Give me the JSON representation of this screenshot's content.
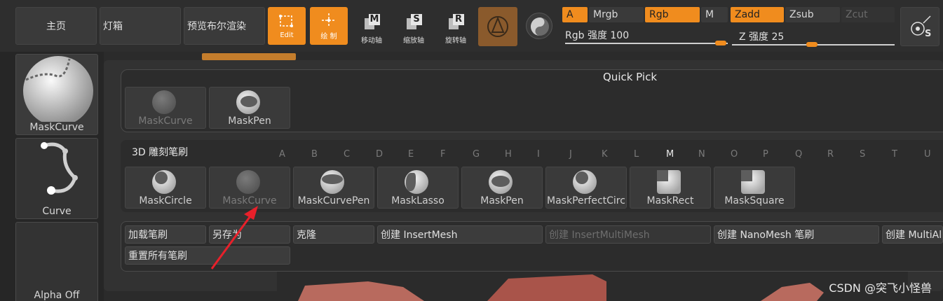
{
  "topbar": {
    "home": "主页",
    "lightbox": "灯箱",
    "preview_bool": "预览布尔渲染",
    "edit": "Edit",
    "draw": "绘 制",
    "move_label": "移动轴",
    "scale_label": "缩放轴",
    "rotate_label": "旋转轴",
    "move_letter": "M",
    "scale_letter": "S",
    "rotate_letter": "R",
    "a": "A",
    "mrgb": "Mrgb",
    "rgb": "Rgb",
    "m": "M",
    "zadd": "Zadd",
    "zsub": "Zsub",
    "zcut": "Zcut",
    "rgb_intensity": "Rgb 强度 100",
    "z_intensity": "Z 强度 25",
    "rgb_intensity_value": 100,
    "z_intensity_value": 25,
    "sym_letter": "S"
  },
  "lefttray": {
    "brush_name": "MaskCurve",
    "stroke_name": "Curve",
    "alpha_name": "Alpha Off"
  },
  "quick_pick": {
    "title": "Quick Pick",
    "items": [
      "MaskCurve",
      "MaskPen"
    ]
  },
  "sculpt": {
    "title": "3D 雕刻笔刷",
    "letters": [
      "A",
      "B",
      "C",
      "D",
      "E",
      "F",
      "G",
      "H",
      "I",
      "J",
      "K",
      "L",
      "M",
      "N",
      "O",
      "P",
      "Q",
      "R",
      "S",
      "T",
      "U"
    ],
    "active_letter": "M",
    "brushes": [
      "MaskCircle",
      "MaskCurve",
      "MaskCurvePen",
      "MaskLasso",
      "MaskPen",
      "MaskPerfectCirc",
      "MaskRect",
      "MaskSquare"
    ]
  },
  "actions": {
    "load": "加载笔刷",
    "save_as": "另存为",
    "clone": "克隆",
    "create_insertmesh": "创建 InsertMesh",
    "create_insertmultimesh": "创建 InsertMultiMesh",
    "create_nanomesh": "创建 NanoMesh 笔刷",
    "create_multialpha": "创建 MultiAl",
    "reset_all": "重置所有笔刷"
  },
  "watermark": "CSDN @突飞小怪兽",
  "colors": {
    "accent": "#f08c1e",
    "annotation_arrow": "#e8202a"
  }
}
